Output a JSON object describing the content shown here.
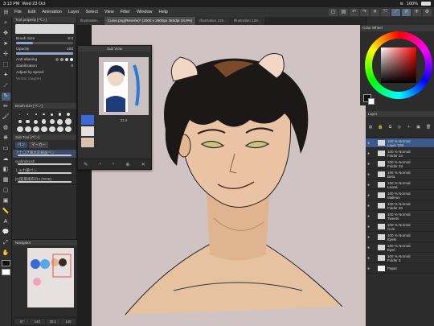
{
  "status": {
    "time": "3:13 PM",
    "date": "Wed 23 Oct",
    "battery": "100%",
    "battery_level": 1.0
  },
  "menu": [
    "File",
    "Edit",
    "Animation",
    "Layer",
    "Select",
    "View",
    "Filter",
    "Window",
    "Help"
  ],
  "tabs": [
    "Illustration...",
    "Cuine.png(Reverie)* (2000 x 2800px 350dpi 18.9%)",
    "Illustration 126...",
    "Illustration 126..."
  ],
  "tool_property": {
    "title": "Tool property [ペン]",
    "brush_size_label": "Brush Size",
    "brush_size_value": "8.0",
    "opacity_label": "Opacity",
    "opacity_value": "100",
    "anti_aliasing_label": "Anti-aliasing",
    "stabilization_label": "Stabilization",
    "stabilization_value": "8",
    "adjust_speed_label": "Adjust by speed",
    "vector_magnet_label": "Vector magnet"
  },
  "brush_size": {
    "title": "Brush size [ペン]"
  },
  "sub_tool": {
    "title": "Sub Tool [ペン]",
    "tabs": [
      "ペン",
      "マーカー"
    ],
    "items": [
      "アナログ風水彩線画ペン",
      "cyokmbrush",
      "しゃれ筆ペン",
      "[G]鉛筆風布の2 (RGB)"
    ]
  },
  "sub_view": {
    "title": "Sub View",
    "zoom": "31.9"
  },
  "navigator": {
    "title": "Navigator",
    "bottom": [
      "67",
      "140",
      "30.2",
      "140"
    ]
  },
  "color_wheel": {
    "title": "Color Wheel"
  },
  "layers": {
    "title": "Layer",
    "items": [
      {
        "blend": "100 % Normal",
        "name": "Layer 108",
        "sel": true
      },
      {
        "blend": "100 % Normal",
        "name": "Folder 34"
      },
      {
        "blend": "100 % Normal",
        "name": "Folder 33"
      },
      {
        "blend": "100 % Normal",
        "name": "Beta"
      },
      {
        "blend": "100 % Normal",
        "name": "Leona"
      },
      {
        "blend": "100 % Normal",
        "name": "Malleus"
      },
      {
        "blend": "100 % Normal",
        "name": "Folder 20"
      },
      {
        "blend": "100 % Normal",
        "name": "Tweets"
      },
      {
        "blend": "100 % Normal",
        "name": "Cuin"
      },
      {
        "blend": "100 % Normal",
        "name": "Epels"
      },
      {
        "blend": "100 % Normal",
        "name": "Epel"
      },
      {
        "blend": "100 % Normal",
        "name": "Folder 5"
      },
      {
        "blend": "",
        "name": "Paper"
      }
    ]
  }
}
